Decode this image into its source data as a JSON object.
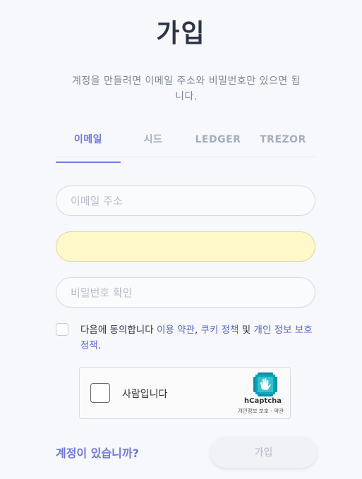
{
  "header": {
    "title": "가입",
    "subtitle": "계정을 만들려면 이메일 주소와 비밀번호만 있으면 됩니다."
  },
  "tabs": [
    {
      "label": "이메일",
      "active": true
    },
    {
      "label": "시드",
      "active": false
    },
    {
      "label": "LEDGER",
      "active": false
    },
    {
      "label": "TREZOR",
      "active": false
    }
  ],
  "form": {
    "email_placeholder": "이메일 주소",
    "password_value": "",
    "confirm_placeholder": "비밀번호 확인"
  },
  "agreement": {
    "prefix": "다음에 동의합니다 ",
    "terms": "이용 약관",
    "sep": ", ",
    "cookies": "쿠키 정책",
    "and": " 및 ",
    "privacy": "개인 정보 보호 정책",
    "suffix": "."
  },
  "captcha": {
    "label": "사람입니다",
    "brand": "hCaptcha",
    "privacy_terms": "개인정보 보호 - 약관"
  },
  "footer": {
    "login_link": "계정이 있습니까?",
    "signup_button": "가입"
  },
  "colors": {
    "accent": "#6f78d8",
    "autofill": "#fff8c8"
  }
}
